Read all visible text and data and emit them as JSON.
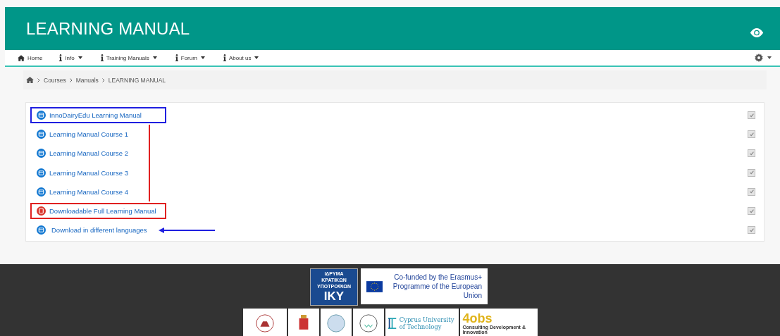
{
  "header": {
    "title": "LEARNING MANUAL"
  },
  "nav": {
    "items": [
      {
        "label": "Home",
        "dropdown": false
      },
      {
        "label": "Info",
        "dropdown": true
      },
      {
        "label": "Training Manuals",
        "dropdown": true
      },
      {
        "label": "Forum",
        "dropdown": true
      },
      {
        "label": "About us",
        "dropdown": true
      }
    ]
  },
  "breadcrumb": [
    "Courses",
    "Manuals",
    "LEARNING MANUAL"
  ],
  "activities": [
    {
      "label": "InnoDairyEdu Learning Manual",
      "kind": "page",
      "boxed": true,
      "bracketed": false,
      "pointed": false,
      "color": "#1f1fe0",
      "checked": true
    },
    {
      "label": "Learning Manual Course 1",
      "kind": "page",
      "boxed": false,
      "bracketed": true,
      "pointed": false,
      "color": "#e02020",
      "checked": true
    },
    {
      "label": "Learning Manual Course 2",
      "kind": "page",
      "boxed": false,
      "bracketed": true,
      "pointed": false,
      "color": "#e02020",
      "checked": true
    },
    {
      "label": "Learning Manual Course 3",
      "kind": "page",
      "boxed": false,
      "bracketed": true,
      "pointed": false,
      "color": "#e02020",
      "checked": true
    },
    {
      "label": "Learning Manual Course 4",
      "kind": "page",
      "boxed": false,
      "bracketed": true,
      "pointed": false,
      "color": "#e02020",
      "checked": true
    },
    {
      "label": "Downloadable Full Learning Manual",
      "kind": "pdf",
      "boxed": true,
      "bracketed": false,
      "pointed": false,
      "color": "#e02020",
      "checked": true
    },
    {
      "label": "Download in different languages",
      "kind": "page",
      "boxed": false,
      "bracketed": false,
      "pointed": true,
      "color": "#1f1fe0",
      "checked": true
    }
  ],
  "footer": {
    "funder": {
      "greek": "ΙΔΡΥΜΑ ΚΡΑΤΙΚΩΝ ΥΠΟΤΡΟΦΙΩΝ",
      "abbr": "IKY"
    },
    "erasmus": "Co-funded by the Erasmus+ Programme of the European Union",
    "cyprus": "Cyprus University of Technology",
    "obs": {
      "brand": "4obs",
      "tagline": "Consulting Development & Innovation"
    }
  }
}
